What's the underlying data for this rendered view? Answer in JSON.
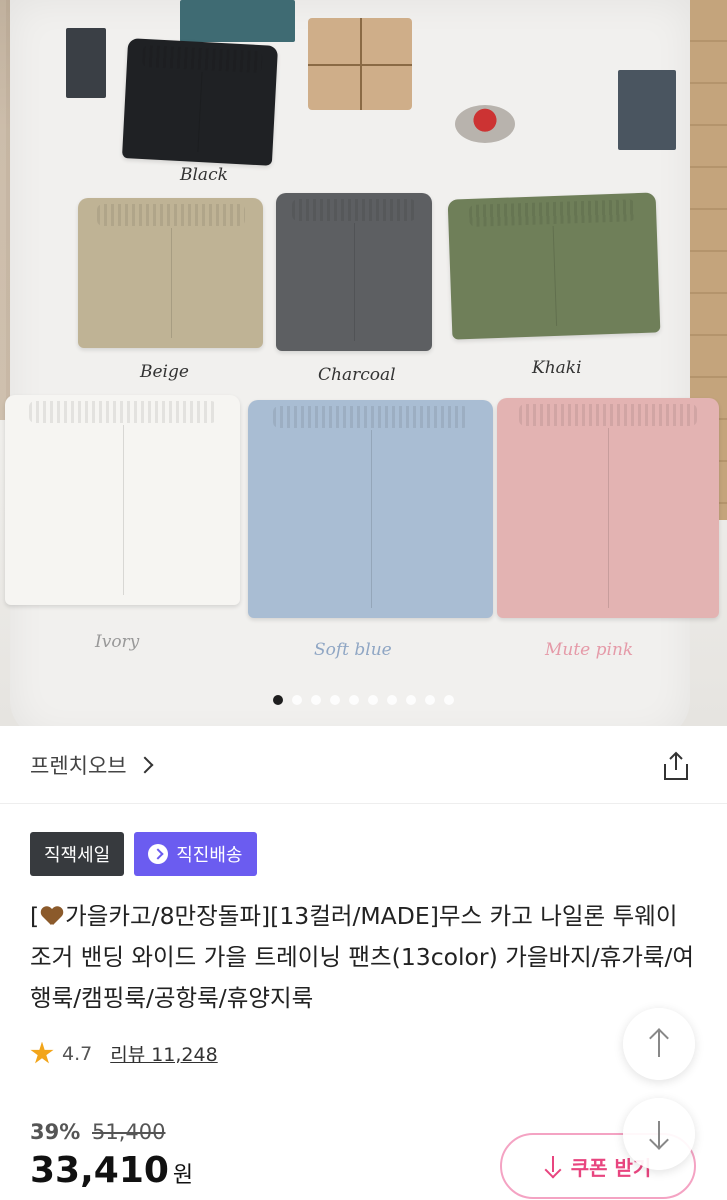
{
  "hero": {
    "color_labels": [
      "Black",
      "Beige",
      "Charcoal",
      "Khaki",
      "Ivory",
      "Soft blue",
      "Mute pink"
    ],
    "carousel_total": 10,
    "carousel_active_index": 0
  },
  "store": {
    "name": "프렌치오브"
  },
  "badges": {
    "sale": "직잭세일",
    "delivery": "직진배송"
  },
  "product": {
    "title_prefix": "[",
    "title": "가을카고/8만장돌파][13컬러/MADE]무스 카고 나일론 투웨이 조거 밴딩 와이드 가을 트레이닝 팬츠(13color) 가을바지/휴가룩/여행룩/캠핑룩/공항룩/휴양지룩"
  },
  "rating": {
    "score": "4.7",
    "review_label": "리뷰 11,248"
  },
  "price": {
    "discount": "39%",
    "original": "51,400",
    "final": "33,410",
    "currency": "원"
  },
  "coupon": {
    "label": "쿠폰 받기"
  },
  "colors": {
    "black": "#1f2124",
    "beige": "#bfb395",
    "charcoal": "#5d5f62",
    "khaki": "#6f7f59",
    "ivory": "#f6f5f2",
    "softblue": "#a9bdd3",
    "mutepink": "#e3b3b2",
    "purple": "#6b5cf0",
    "pink": "#e8457f",
    "star": "#f2a51a"
  }
}
